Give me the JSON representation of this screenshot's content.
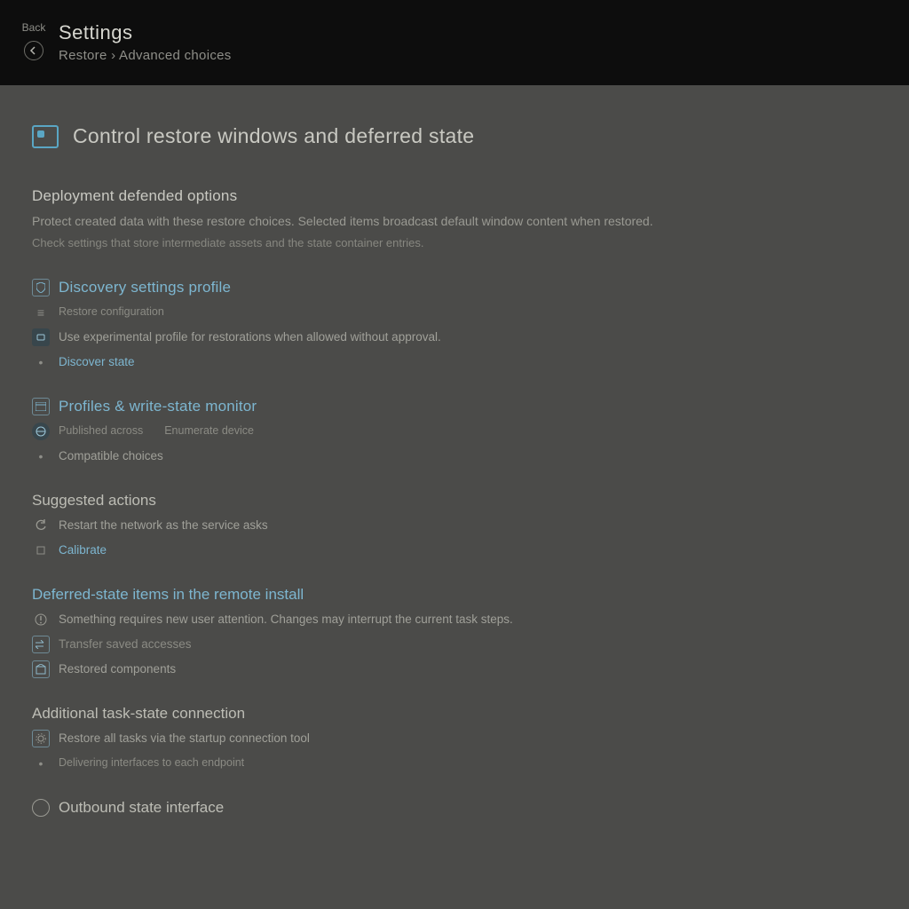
{
  "topbar": {
    "back_label": "Back",
    "title": "Settings",
    "breadcrumb": "Restore › Advanced choices"
  },
  "hero": {
    "title": "Control restore windows and deferred state"
  },
  "intro": {
    "heading": "Deployment defended options",
    "line1": "Protect created data with these restore choices. Selected items broadcast default window content when restored.",
    "line2": "Check settings that store intermediate assets and the state container entries."
  },
  "discovery": {
    "heading": "Discovery settings profile",
    "row1": "Restore configuration",
    "row2": "Use experimental profile for restorations when allowed without approval.",
    "row3": "Discover state"
  },
  "profiles": {
    "heading": "Profiles & write-state monitor",
    "row1": "Published across",
    "row1_badge": "Enumerate device",
    "row2": "Compatible choices"
  },
  "suggested": {
    "heading": "Suggested actions",
    "row1": "Restart the network as the service asks",
    "row2": "Calibrate"
  },
  "deferred": {
    "heading": "Deferred-state items in the remote install",
    "row1": "Something requires new user attention. Changes may interrupt the current task steps.",
    "row2": "Transfer saved accesses",
    "row3": "Restored components"
  },
  "additional": {
    "heading": "Additional task-state connection",
    "row1": "Restore all tasks via the startup connection tool",
    "row2": "Delivering interfaces to each endpoint"
  },
  "outbound": {
    "heading": "Outbound state interface"
  }
}
